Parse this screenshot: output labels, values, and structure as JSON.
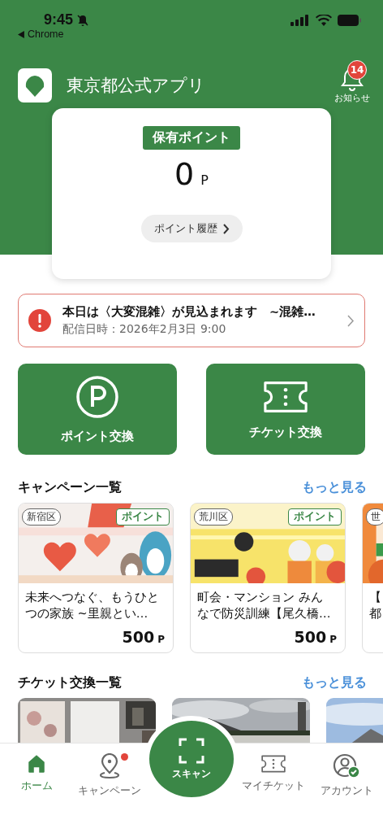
{
  "status_bar": {
    "time": "9:45",
    "back_label": "Chrome"
  },
  "header": {
    "title": "東京都公式アプリ",
    "notifications": {
      "count": "14",
      "label": "お知らせ"
    }
  },
  "points": {
    "label": "保有ポイント",
    "value": "0",
    "unit": "P",
    "history_button": "ポイント履歴"
  },
  "alert": {
    "title": "本日は〈大変混雑〉が見込まれます　~混雑…",
    "date": "配信日時：2026年2月3日 9:00"
  },
  "actions": [
    {
      "kind": "points",
      "label": "ポイント交換"
    },
    {
      "kind": "ticket",
      "label": "チケット交換"
    }
  ],
  "campaigns": {
    "title": "キャンペーン一覧",
    "more": "もっと見る",
    "items": [
      {
        "district": "新宿区",
        "tag": "ポイント",
        "title_lines": [
          "未来へつなぐ、もうひと",
          "つの家族 ~里親とい…"
        ],
        "price": "500",
        "unit": "P",
        "kind": "picture"
      },
      {
        "district": "荒川区",
        "tag": "ポイント",
        "title_lines": [
          "町会・マンション みん",
          "なで防災訓練【尾久橋…"
        ],
        "price": "500",
        "unit": "P",
        "kind": "picture"
      },
      {
        "district": "世",
        "title_lines": [
          "【",
          "都"
        ],
        "kind": "picture"
      }
    ]
  },
  "tickets": {
    "title": "チケット交換一覧",
    "more": "もっと見る"
  },
  "nav": {
    "scan_label": "スキャン",
    "items": [
      {
        "kind": "home",
        "label": "ホーム",
        "selected": true,
        "has_notification": false
      },
      {
        "kind": "campaign",
        "label": "キャンペーン",
        "selected": false,
        "has_notification": true
      },
      {
        "kind": "scan"
      },
      {
        "kind": "ticket",
        "label": "マイチケット",
        "selected": false,
        "has_notification": false
      },
      {
        "kind": "account",
        "label": "アカウント",
        "selected": false,
        "has_notification": false
      }
    ]
  }
}
